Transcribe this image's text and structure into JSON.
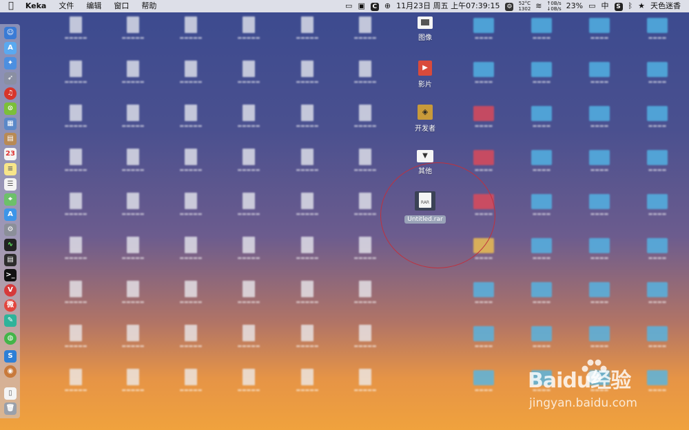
{
  "menubar": {
    "app": "Keka",
    "menus": [
      "文件",
      "编辑",
      "窗口",
      "帮助"
    ],
    "date_time": "11月23日 周五 上午07:39:15",
    "cpu_temp": "52°C",
    "fan_rpm": "1302",
    "net_up": "0B/s",
    "net_down": "0B/s",
    "battery": "23%",
    "input_method": "中",
    "user": "天色迷香"
  },
  "desktop": {
    "sharp_icons": [
      {
        "label": "图像",
        "kind": "folder"
      },
      {
        "label": "影片",
        "kind": "folder"
      },
      {
        "label": "开发者",
        "kind": "folder"
      },
      {
        "label": "其他",
        "kind": "folder"
      },
      {
        "label": "Untitled.rar",
        "kind": "rar-file",
        "selected": true
      }
    ]
  },
  "watermark": {
    "main": "Baidu经验",
    "sub": "jingyan.baidu.com"
  },
  "colors": {
    "menubar_bg": "#ebebf0",
    "folder_blue": "#52b7e8",
    "folder_red": "#e34a58",
    "highlight_circle": "#c0303d"
  }
}
